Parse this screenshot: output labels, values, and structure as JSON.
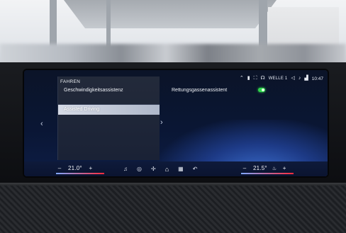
{
  "menu": {
    "header": "FAHREN",
    "items": [
      {
        "label": "Geschwindigkeitsassistenz",
        "highlighted": false
      },
      {
        "label": "Assisted Driving",
        "highlighted": true
      }
    ]
  },
  "detail": {
    "label": "Rettungsgassenassistent",
    "toggle_on": true
  },
  "status_bar": {
    "radio": "WELLE 1",
    "time": "10:47",
    "icons": [
      "navigation-icon",
      "phone-icon",
      "connectivity-icon",
      "radio-icon",
      "volume-icon",
      "microphone-icon",
      "signal-icon"
    ]
  },
  "climate": {
    "left_temp": "21.0°",
    "right_temp": "21.5°",
    "minus": "–",
    "plus": "+"
  },
  "nav_bar": {
    "icons": [
      "media-icon",
      "vehicle-icon",
      "fan-icon",
      "home-icon",
      "apps-icon",
      "back-icon"
    ]
  },
  "colors": {
    "toggle_on": "#2fd54b",
    "highlight": "#c9d0de",
    "screen_bg": "#0a1634"
  }
}
